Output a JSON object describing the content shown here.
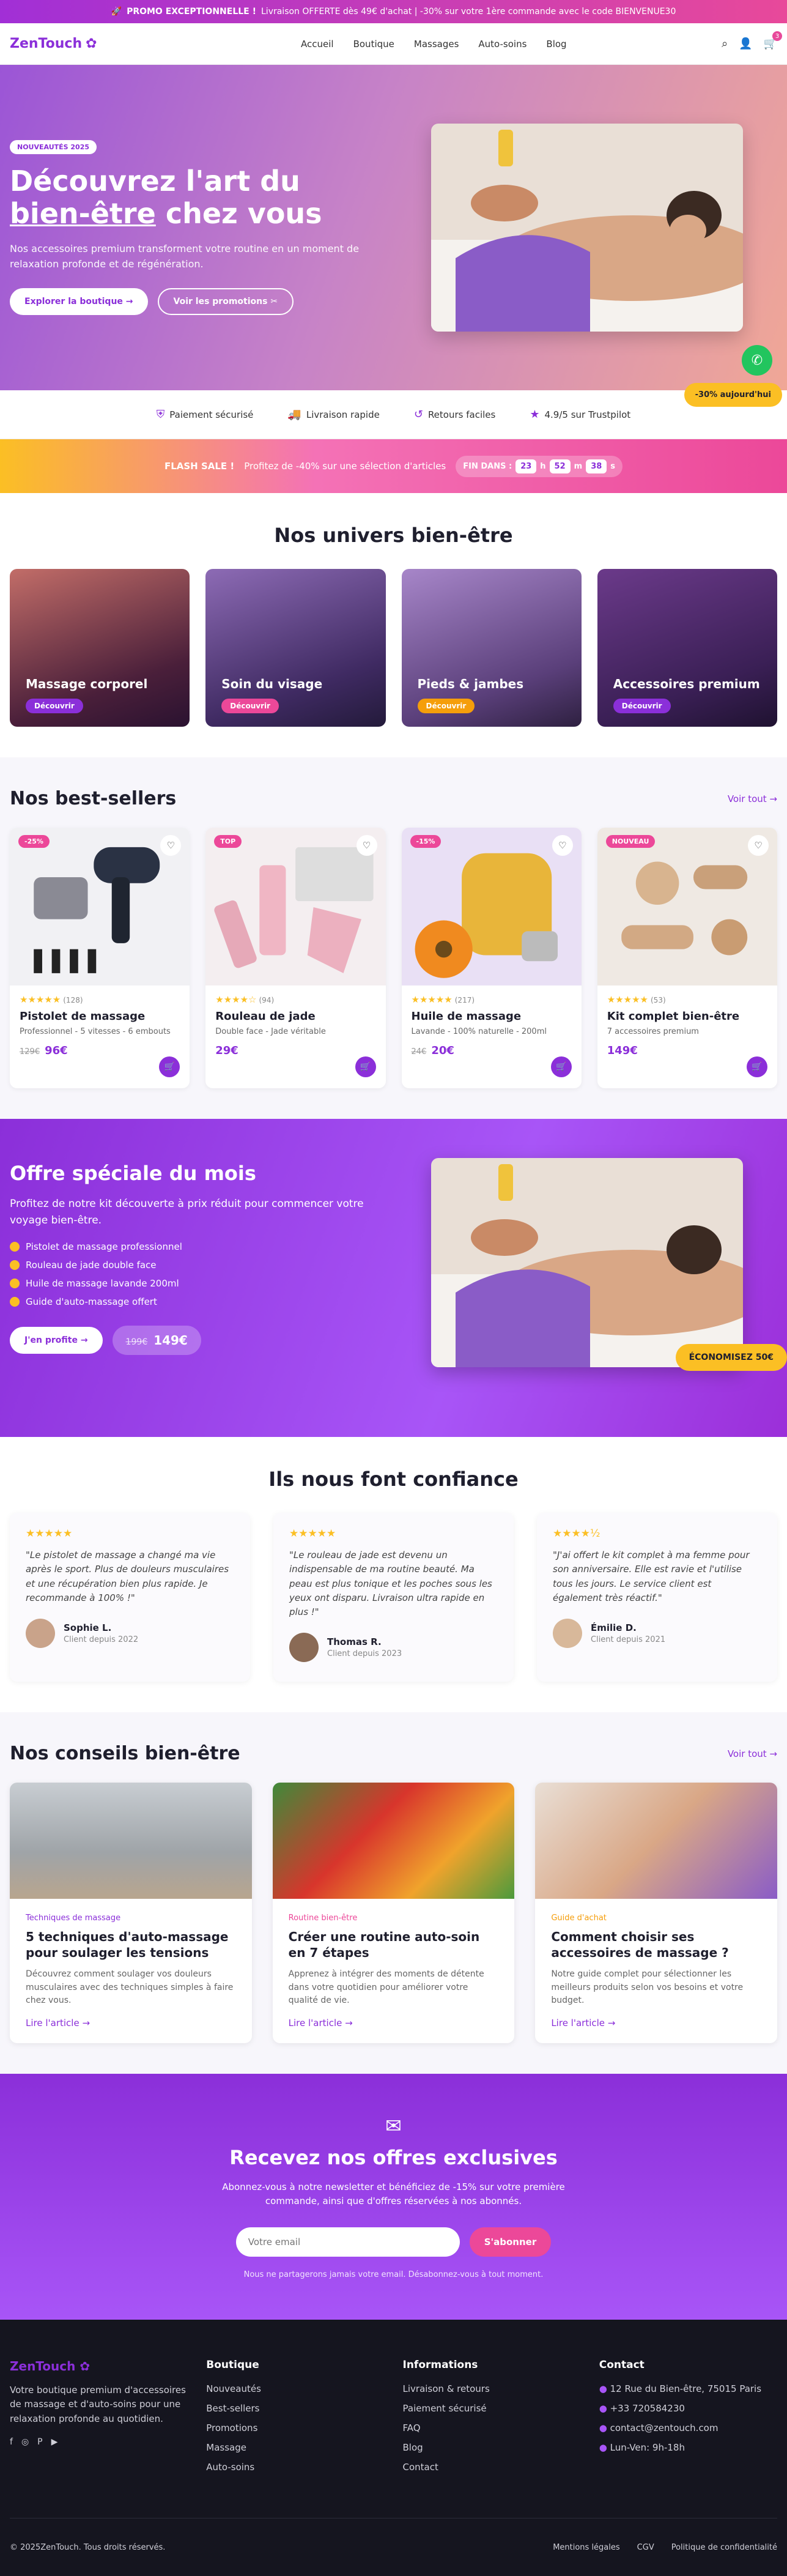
{
  "promo": {
    "emoji": "🚀",
    "bold": "PROMO EXCEPTIONNELLE !",
    "text": "Livraison OFFERTE dès 49€ d'achat | -30% sur votre 1ère commande avec le code BIENVENUE30"
  },
  "nav": {
    "logo": "ZenTouch",
    "links": [
      "Accueil",
      "Boutique",
      "Massages",
      "Auto-soins",
      "Blog"
    ],
    "cart_count": "3"
  },
  "hero": {
    "badge": "NOUVEAUTÉS 2025",
    "title_part1": "Découvrez l'art du ",
    "title_underlined": "bien-être",
    "title_part2": " chez vous",
    "text": "Nos accessoires premium transforment votre routine en un moment de relaxation profonde et de régénération.",
    "btn_primary": "Explorer la boutique  →",
    "btn_secondary": "Voir les promotions  ✂",
    "discount_pill": "-30% aujourd'hui"
  },
  "trust": [
    "Paiement sécurisé",
    "Livraison rapide",
    "Retours faciles",
    "4.9/5 sur Trustpilot"
  ],
  "flash": {
    "bold": "FLASH SALE !",
    "text": "Profitez de -40% sur une sélection d'articles",
    "label": "FIN DANS :",
    "h": "23",
    "h_unit": "h",
    "m": "52",
    "m_unit": "m",
    "s": "38",
    "s_unit": "s"
  },
  "universes": {
    "title": "Nos univers bien-être",
    "items": [
      {
        "label": "Massage corporel",
        "cta": "Découvrir",
        "color": "#8b2fd9"
      },
      {
        "label": "Soin du visage",
        "cta": "Découvrir",
        "color": "#ec4899"
      },
      {
        "label": "Pieds & jambes",
        "cta": "Découvrir",
        "color": "#f59e0b"
      },
      {
        "label": "Accessoires premium",
        "cta": "Découvrir",
        "color": "#8b2fd9"
      }
    ]
  },
  "bestsellers": {
    "title": "Nos best-sellers",
    "see_all": "Voir tout  →",
    "items": [
      {
        "tag": "-25%",
        "tag_color": "#ec4899",
        "stars": "★★★★★",
        "reviews": "(128)",
        "name": "Pistolet de massage",
        "desc": "Professionnel - 5 vitesses - 6 embouts",
        "old": "129€",
        "price": "96€"
      },
      {
        "tag": "TOP",
        "tag_color": "#ec4899",
        "stars": "★★★★☆",
        "reviews": "(94)",
        "name": "Rouleau de jade",
        "desc": "Double face - Jade véritable",
        "old": "",
        "price": "29€"
      },
      {
        "tag": "-15%",
        "tag_color": "#ec4899",
        "stars": "★★★★★",
        "reviews": "(217)",
        "name": "Huile de massage",
        "desc": "Lavande - 100% naturelle - 200ml",
        "old": "24€",
        "price": "20€"
      },
      {
        "tag": "NOUVEAU",
        "tag_color": "#ec4899",
        "stars": "★★★★★",
        "reviews": "(53)",
        "name": "Kit complet bien-être",
        "desc": "7 accessoires premium",
        "old": "",
        "price": "149€"
      }
    ]
  },
  "offer": {
    "title": "Offre spéciale du mois",
    "text": "Profitez de notre kit découverte à prix réduit pour commencer votre voyage bien-être.",
    "items": [
      "Pistolet de massage professionnel",
      "Rouleau de jade double face",
      "Huile de massage lavande 200ml",
      "Guide d'auto-massage offert"
    ],
    "btn": "J'en profite  →",
    "old_price": "199€",
    "price": "149€",
    "pill": "ÉCONOMISEZ 50€"
  },
  "testimonials": {
    "title": "Ils nous font confiance",
    "items": [
      {
        "stars": "★★★★★",
        "text": "\"Le pistolet de massage a changé ma vie après le sport. Plus de douleurs musculaires et une récupération bien plus rapide. Je recommande à 100% !\"",
        "name": "Sophie L.",
        "since": "Client depuis 2022"
      },
      {
        "stars": "★★★★★",
        "text": "\"Le rouleau de jade est devenu un indispensable de ma routine beauté. Ma peau est plus tonique et les poches sous les yeux ont disparu. Livraison ultra rapide en plus !\"",
        "name": "Thomas R.",
        "since": "Client depuis 2023"
      },
      {
        "stars": "★★★★½",
        "text": "\"J'ai offert le kit complet à ma femme pour son anniversaire. Elle est ravie et l'utilise tous les jours. Le service client est également très réactif.\"",
        "name": "Émilie D.",
        "since": "Client depuis 2021"
      }
    ]
  },
  "blog": {
    "title": "Nos conseils bien-être",
    "see_all": "Voir tout  →",
    "items": [
      {
        "cat": "Techniques de massage",
        "cat_color": "#8b2fd9",
        "title": "5 techniques d'auto-massage pour soulager les tensions",
        "desc": "Découvrez comment soulager vos douleurs musculaires avec des techniques simples à faire chez vous.",
        "more": "Lire l'article  →"
      },
      {
        "cat": "Routine bien-être",
        "cat_color": "#ec4899",
        "title": "Créer une routine auto-soin en 7 étapes",
        "desc": "Apprenez à intégrer des moments de détente dans votre quotidien pour améliorer votre qualité de vie.",
        "more": "Lire l'article  →"
      },
      {
        "cat": "Guide d'achat",
        "cat_color": "#f59e0b",
        "title": "Comment choisir ses accessoires de massage ?",
        "desc": "Notre guide complet pour sélectionner les meilleurs produits selon vos besoins et votre budget.",
        "more": "Lire l'article  →"
      }
    ]
  },
  "newsletter": {
    "title": "Recevez nos offres exclusives",
    "text": "Abonnez-vous à notre newsletter et bénéficiez de -15% sur votre première commande, ainsi que d'offres réservées à nos abonnés.",
    "placeholder": "Votre email",
    "btn": "S'abonner",
    "note": "Nous ne partagerons jamais votre email. Désabonnez-vous à tout moment."
  },
  "footer": {
    "logo": "ZenTouch",
    "desc": "Votre boutique premium d'accessoires de massage et d'auto-soins pour une relaxation profonde au quotidien.",
    "col2_title": "Boutique",
    "col2": [
      "Nouveautés",
      "Best-sellers",
      "Promotions",
      "Massage",
      "Auto-soins"
    ],
    "col3_title": "Informations",
    "col3": [
      "Livraison & retours",
      "Paiement sécurisé",
      "FAQ",
      "Blog",
      "Contact"
    ],
    "col4_title": "Contact",
    "col4": [
      "12 Rue du Bien-être, 75015 Paris",
      "+33 720584230",
      "contact@zentouch.com",
      "Lun-Ven: 9h-18h"
    ],
    "copyright": "© 2025ZenTouch. Tous droits réservés.",
    "legal": [
      "Mentions légales",
      "CGV",
      "Politique de confidentialité"
    ]
  }
}
